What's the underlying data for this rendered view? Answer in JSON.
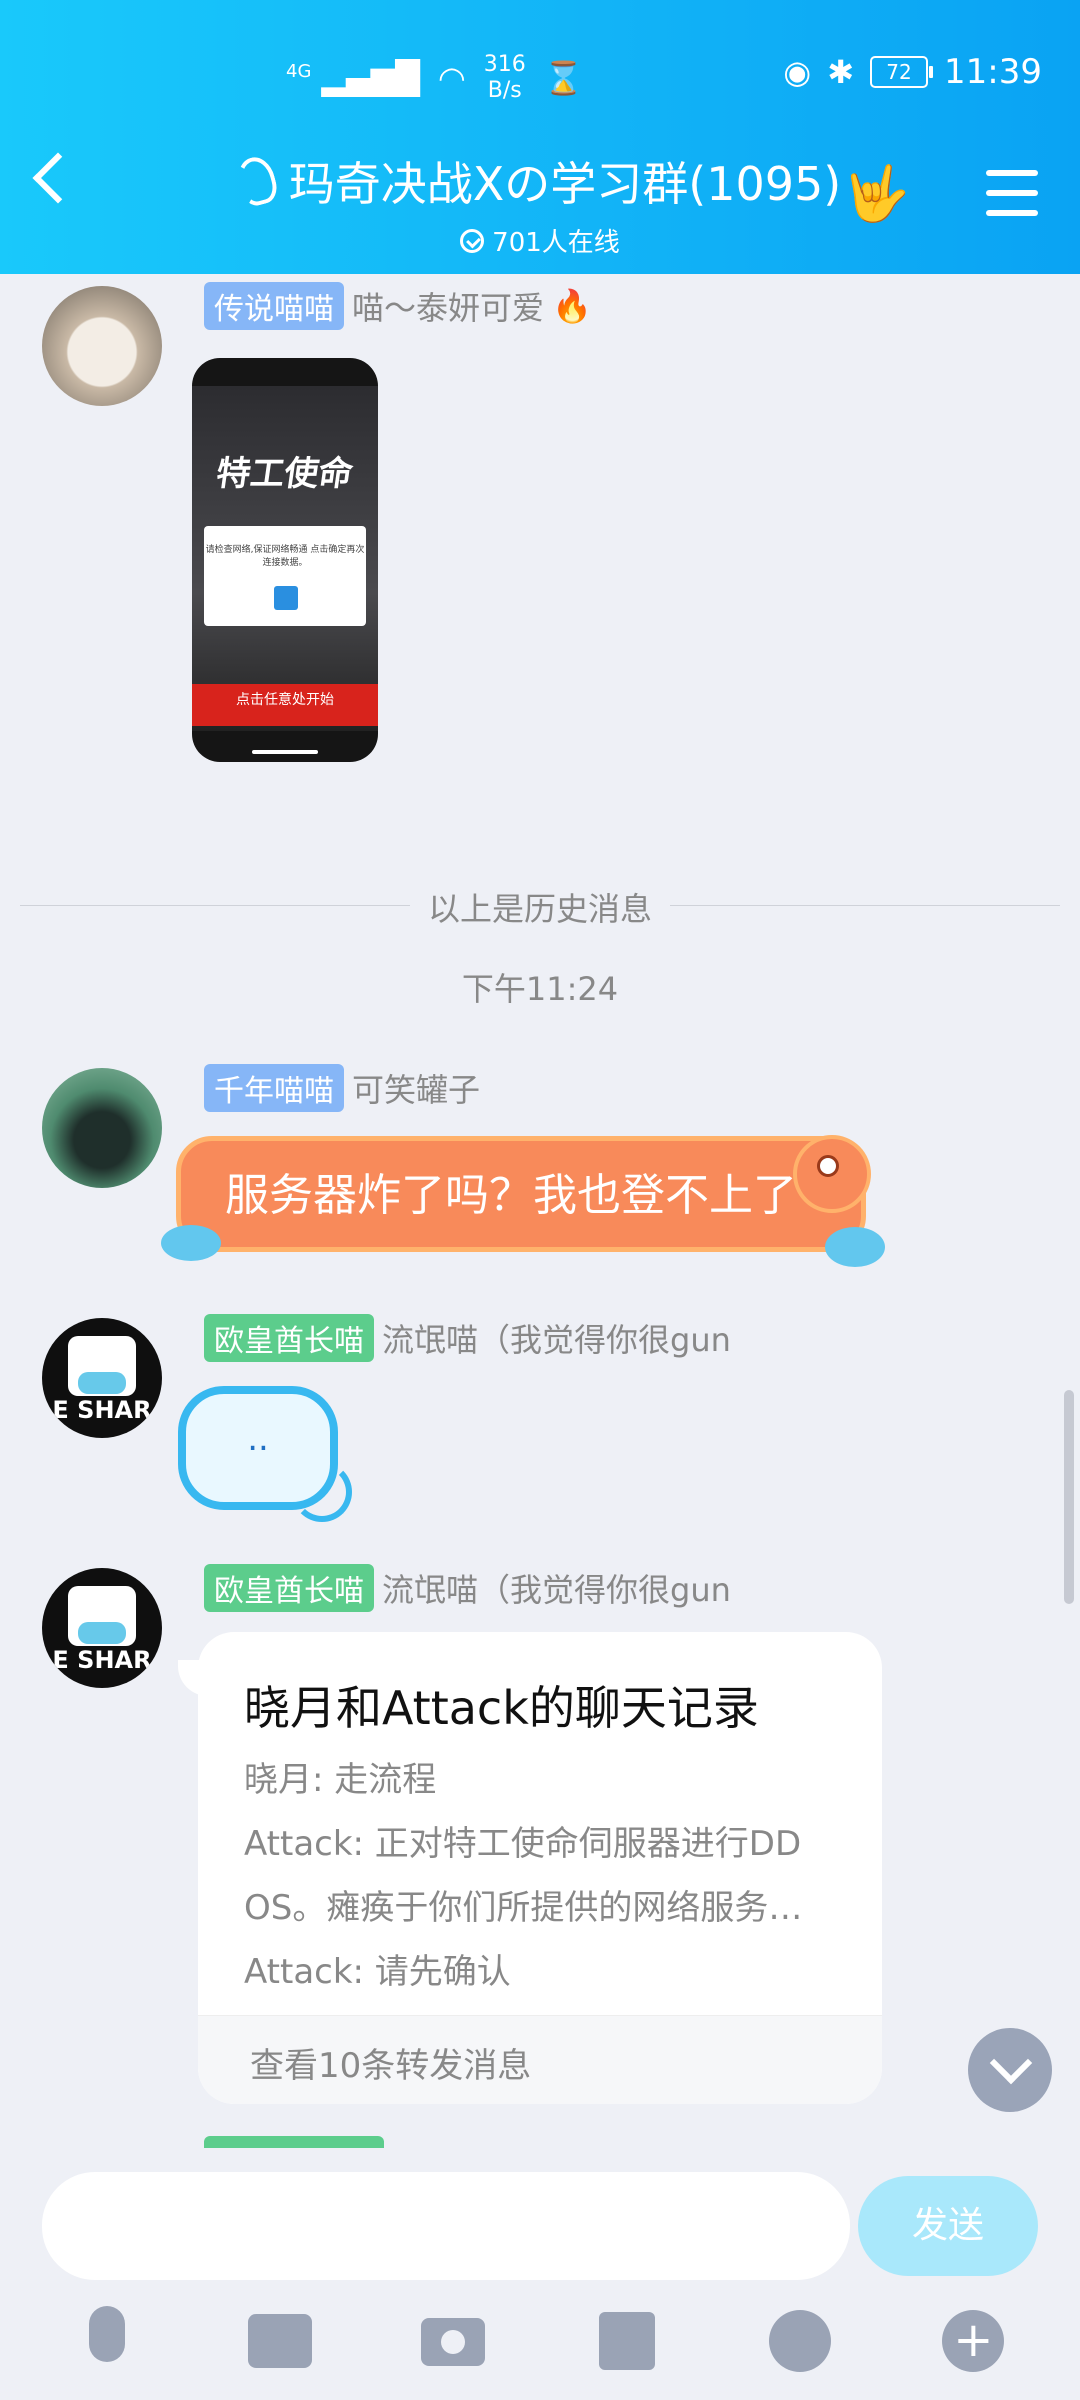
{
  "status_bar": {
    "network": "4G",
    "speed_value": "316",
    "speed_unit": "B/s",
    "battery": "72",
    "time": "11:39"
  },
  "header": {
    "title": "玛奇决战Xの学习群(1095)",
    "online": "701人在线"
  },
  "messages": [
    {
      "badge": "传说喵喵",
      "badge_color": "#86b6f7",
      "sender": "喵～泰妍可爱",
      "type": "image",
      "image": {
        "logo": "特工使命",
        "dialog_text": "请检查网络,保证网络畅通 点击确定再次连接数据。",
        "bottom_text": "点击任意处开始"
      }
    },
    {
      "badge": "千年喵喵",
      "badge_color": "#86b6f7",
      "sender": "可笑罐子",
      "type": "text",
      "text": "服务器炸了吗？我也登不上了"
    },
    {
      "badge": "欧皇酋长喵",
      "badge_color": "#5ccd8c",
      "sender": "流氓喵（我觉得你很gun",
      "type": "voice",
      "voice_text": "..",
      "avatar_text": "E SHAR"
    },
    {
      "badge": "欧皇酋长喵",
      "badge_color": "#5ccd8c",
      "sender": "流氓喵（我觉得你很gun",
      "type": "forward",
      "avatar_text": "E SHAR",
      "card": {
        "title": "晓月和Attack的聊天记录",
        "lines": [
          "晓月:  走流程",
          "Attack:  正对特工使命伺服器进行DD",
          "OS。瘫痪于你们所提供的网络服务…",
          "Attack:  请先确认"
        ],
        "footer": "查看10条转发消息"
      }
    }
  ],
  "divider": {
    "history": "以上是历史消息",
    "timestamp": "下午11:24"
  },
  "input": {
    "placeholder": "",
    "send_label": "发送"
  },
  "toolbar": [
    "voice-icon",
    "image-icon",
    "camera-icon",
    "red-packet-icon",
    "emoji-icon",
    "plus-icon"
  ],
  "colors": {
    "header_start": "#19c9fb",
    "header_end": "#0aa3f3",
    "send_button": "#a9e8fb",
    "bubble_orange": "#f88a5a"
  }
}
